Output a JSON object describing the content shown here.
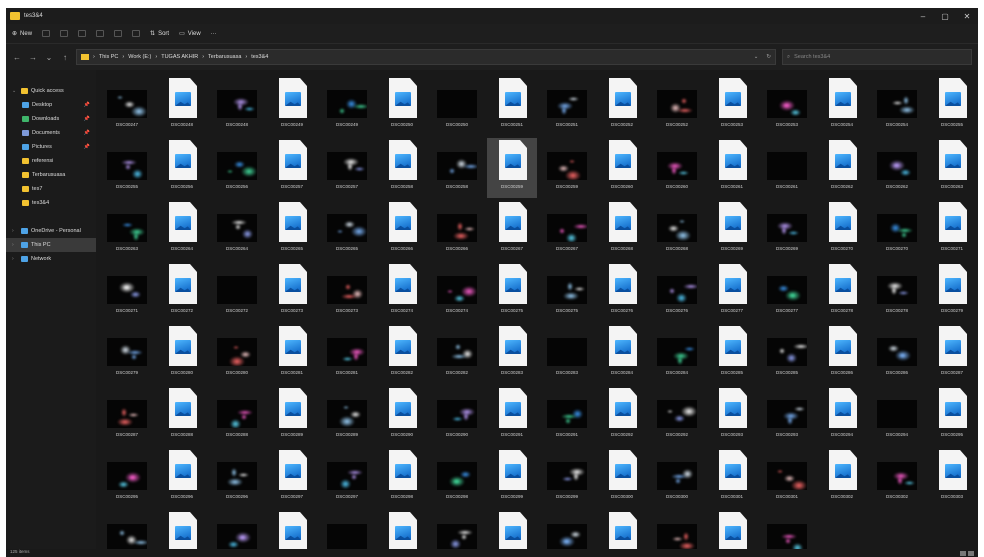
{
  "window": {
    "title": "tes3&4",
    "min": "–",
    "max": "▢",
    "close": "✕"
  },
  "toolbar": {
    "new_label": "New",
    "sort_label": "Sort",
    "view_label": "View",
    "more_label": "···"
  },
  "address": {
    "breadcrumbs": [
      "This PC",
      "Work (E:)",
      "TUGAS AKHIR",
      "Terbarusuasa",
      "tes3&4"
    ],
    "search_placeholder": "Search tes3&4"
  },
  "sidebar": {
    "items": [
      {
        "label": "Quick access",
        "pinned": false,
        "color": "#f2c230"
      },
      {
        "label": "Desktop",
        "pinned": true,
        "color": "#4ea3e6"
      },
      {
        "label": "Downloads",
        "pinned": true,
        "color": "#3fb56b"
      },
      {
        "label": "Documents",
        "pinned": true,
        "color": "#7e9ad9"
      },
      {
        "label": "Pictures",
        "pinned": true,
        "color": "#4ea3e6"
      },
      {
        "label": "referensi",
        "pinned": false,
        "color": "#f2c230"
      },
      {
        "label": "Terbarusuasa",
        "pinned": false,
        "color": "#f2c230"
      },
      {
        "label": "tes7",
        "pinned": false,
        "color": "#f2c230"
      },
      {
        "label": "tes3&4",
        "pinned": false,
        "color": "#f2c230"
      },
      {
        "label": "OneDrive - Personal",
        "pinned": false,
        "color": "#4ea3e6"
      },
      {
        "label": "This PC",
        "pinned": false,
        "color": "#4ea3e6"
      },
      {
        "label": "Network",
        "pinned": false,
        "color": "#4ea3e6"
      }
    ]
  },
  "files": [
    {
      "name": "DSC00247",
      "type": "thumb"
    },
    {
      "name": "DSC00248",
      "type": "doc"
    },
    {
      "name": "DSC00248",
      "type": "thumb"
    },
    {
      "name": "DSC00249",
      "type": "doc"
    },
    {
      "name": "DSC00249",
      "type": "thumb"
    },
    {
      "name": "DSC00250",
      "type": "doc"
    },
    {
      "name": "DSC00250",
      "type": "thumb"
    },
    {
      "name": "DSC00251",
      "type": "doc"
    },
    {
      "name": "DSC00251",
      "type": "thumb"
    },
    {
      "name": "DSC00252",
      "type": "doc"
    },
    {
      "name": "DSC00252",
      "type": "thumb"
    },
    {
      "name": "DSC00253",
      "type": "doc"
    },
    {
      "name": "DSC00253",
      "type": "thumb"
    },
    {
      "name": "DSC00254",
      "type": "doc"
    },
    {
      "name": "DSC00254",
      "type": "thumb"
    },
    {
      "name": "DSC00255",
      "type": "doc"
    },
    {
      "name": "DSC00255",
      "type": "thumb"
    },
    {
      "name": "DSC00256",
      "type": "doc"
    },
    {
      "name": "DSC00256",
      "type": "thumb"
    },
    {
      "name": "DSC00257",
      "type": "doc"
    },
    {
      "name": "DSC00257",
      "type": "thumb"
    },
    {
      "name": "DSC00258",
      "type": "doc"
    },
    {
      "name": "DSC00258",
      "type": "thumb"
    },
    {
      "name": "DSC00259",
      "type": "doc",
      "selected": true
    },
    {
      "name": "DSC00259",
      "type": "thumb"
    },
    {
      "name": "DSC00260",
      "type": "doc"
    },
    {
      "name": "DSC00260",
      "type": "thumb"
    },
    {
      "name": "DSC00261",
      "type": "doc"
    },
    {
      "name": "DSC00261",
      "type": "thumb"
    },
    {
      "name": "DSC00262",
      "type": "doc"
    },
    {
      "name": "DSC00262",
      "type": "thumb"
    },
    {
      "name": "DSC00263",
      "type": "doc"
    },
    {
      "name": "DSC00263",
      "type": "thumb"
    },
    {
      "name": "DSC00264",
      "type": "doc"
    },
    {
      "name": "DSC00264",
      "type": "thumb"
    },
    {
      "name": "DSC00265",
      "type": "doc"
    },
    {
      "name": "DSC00265",
      "type": "thumb"
    },
    {
      "name": "DSC00266",
      "type": "doc"
    },
    {
      "name": "DSC00266",
      "type": "thumb"
    },
    {
      "name": "DSC00267",
      "type": "doc"
    },
    {
      "name": "DSC00267",
      "type": "thumb"
    },
    {
      "name": "DSC00268",
      "type": "doc"
    },
    {
      "name": "DSC00268",
      "type": "thumb"
    },
    {
      "name": "DSC00269",
      "type": "doc"
    },
    {
      "name": "DSC00269",
      "type": "thumb"
    },
    {
      "name": "DSC00270",
      "type": "doc"
    },
    {
      "name": "DSC00270",
      "type": "thumb"
    },
    {
      "name": "DSC00271",
      "type": "doc"
    },
    {
      "name": "DSC00271",
      "type": "thumb"
    },
    {
      "name": "DSC00272",
      "type": "doc"
    },
    {
      "name": "DSC00272",
      "type": "thumb"
    },
    {
      "name": "DSC00273",
      "type": "doc"
    },
    {
      "name": "DSC00273",
      "type": "thumb"
    },
    {
      "name": "DSC00274",
      "type": "doc"
    },
    {
      "name": "DSC00274",
      "type": "thumb"
    },
    {
      "name": "DSC00275",
      "type": "doc"
    },
    {
      "name": "DSC00275",
      "type": "thumb"
    },
    {
      "name": "DSC00276",
      "type": "doc"
    },
    {
      "name": "DSC00276",
      "type": "thumb"
    },
    {
      "name": "DSC00277",
      "type": "doc"
    },
    {
      "name": "DSC00277",
      "type": "thumb"
    },
    {
      "name": "DSC00278",
      "type": "doc"
    },
    {
      "name": "DSC00278",
      "type": "thumb"
    },
    {
      "name": "DSC00279",
      "type": "doc"
    },
    {
      "name": "DSC00279",
      "type": "thumb"
    },
    {
      "name": "DSC00280",
      "type": "doc"
    },
    {
      "name": "DSC00280",
      "type": "thumb"
    },
    {
      "name": "DSC00281",
      "type": "doc"
    },
    {
      "name": "DSC00281",
      "type": "thumb"
    },
    {
      "name": "DSC00282",
      "type": "doc"
    },
    {
      "name": "DSC00282",
      "type": "thumb"
    },
    {
      "name": "DSC00283",
      "type": "doc"
    },
    {
      "name": "DSC00283",
      "type": "thumb"
    },
    {
      "name": "DSC00284",
      "type": "doc"
    },
    {
      "name": "DSC00284",
      "type": "thumb"
    },
    {
      "name": "DSC00285",
      "type": "doc"
    },
    {
      "name": "DSC00285",
      "type": "thumb"
    },
    {
      "name": "DSC00286",
      "type": "doc"
    },
    {
      "name": "DSC00286",
      "type": "thumb"
    },
    {
      "name": "DSC00287",
      "type": "doc"
    },
    {
      "name": "DSC00287",
      "type": "thumb"
    },
    {
      "name": "DSC00288",
      "type": "doc"
    },
    {
      "name": "DSC00288",
      "type": "thumb"
    },
    {
      "name": "DSC00289",
      "type": "doc"
    },
    {
      "name": "DSC00289",
      "type": "thumb"
    },
    {
      "name": "DSC00290",
      "type": "doc"
    },
    {
      "name": "DSC00290",
      "type": "thumb"
    },
    {
      "name": "DSC00291",
      "type": "doc"
    },
    {
      "name": "DSC00291",
      "type": "thumb"
    },
    {
      "name": "DSC00292",
      "type": "doc"
    },
    {
      "name": "DSC00292",
      "type": "thumb"
    },
    {
      "name": "DSC00293",
      "type": "doc"
    },
    {
      "name": "DSC00293",
      "type": "thumb"
    },
    {
      "name": "DSC00294",
      "type": "doc"
    },
    {
      "name": "DSC00294",
      "type": "thumb"
    },
    {
      "name": "DSC00295",
      "type": "doc"
    },
    {
      "name": "DSC00295",
      "type": "thumb"
    },
    {
      "name": "DSC00296",
      "type": "doc"
    },
    {
      "name": "DSC00296",
      "type": "thumb"
    },
    {
      "name": "DSC00297",
      "type": "doc"
    },
    {
      "name": "DSC00297",
      "type": "thumb"
    },
    {
      "name": "DSC00298",
      "type": "doc"
    },
    {
      "name": "DSC00298",
      "type": "thumb"
    },
    {
      "name": "DSC00299",
      "type": "doc"
    },
    {
      "name": "DSC00299",
      "type": "thumb"
    },
    {
      "name": "DSC00300",
      "type": "doc"
    },
    {
      "name": "DSC00300",
      "type": "thumb"
    },
    {
      "name": "DSC00301",
      "type": "doc"
    },
    {
      "name": "DSC00301",
      "type": "thumb"
    },
    {
      "name": "DSC00302",
      "type": "doc"
    },
    {
      "name": "DSC00302",
      "type": "thumb"
    },
    {
      "name": "DSC00303",
      "type": "doc"
    },
    {
      "name": "",
      "type": "thumb"
    },
    {
      "name": "",
      "type": "doc"
    },
    {
      "name": "",
      "type": "thumb"
    },
    {
      "name": "",
      "type": "doc"
    },
    {
      "name": "",
      "type": "thumb"
    },
    {
      "name": "",
      "type": "doc"
    },
    {
      "name": "",
      "type": "thumb"
    },
    {
      "name": "",
      "type": "doc"
    },
    {
      "name": "",
      "type": "thumb"
    },
    {
      "name": "",
      "type": "doc"
    },
    {
      "name": "",
      "type": "thumb"
    },
    {
      "name": "",
      "type": "doc"
    },
    {
      "name": "",
      "type": "thumb"
    }
  ],
  "status": {
    "items_count": "125 items"
  }
}
